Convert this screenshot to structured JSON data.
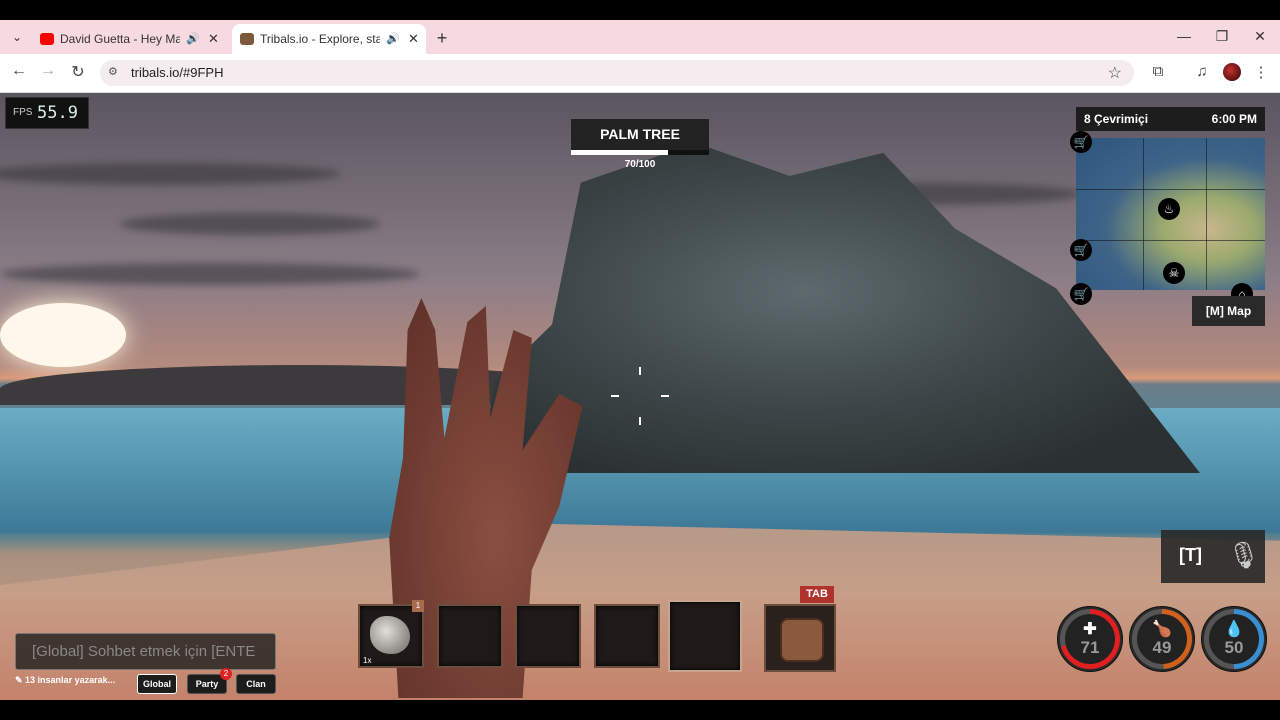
{
  "browser": {
    "tabs": [
      {
        "title": "David Guetta - Hey Mama (",
        "favicon_color": "#ff0000"
      },
      {
        "title": "Tribals.io - Explore, start cla",
        "favicon_color": "#7a5a3a"
      }
    ],
    "new_tab": "+",
    "url": "tribals.io/#9FPH",
    "window_controls": {
      "minimize": "—",
      "restore": "❐",
      "close": "✕"
    }
  },
  "hud": {
    "fps_label": "FPS",
    "fps_value": "55.9",
    "target": {
      "name": "PALM TREE",
      "hp_text": "70/100",
      "hp_fraction": 0.7
    },
    "online": "8 Çevrimiçi",
    "time": "6:00 PM",
    "map_button": "[M] Map",
    "voice_key": "[T]",
    "stats": [
      {
        "name": "health",
        "icon": "✚",
        "value": "71",
        "color": "#e02020"
      },
      {
        "name": "hunger",
        "icon": "🍗",
        "value": "49",
        "color": "#d0601e"
      },
      {
        "name": "thirst",
        "icon": "💧",
        "value": "50",
        "color": "#3a8fd0"
      }
    ],
    "hotbar": {
      "slot1_key": "1",
      "slot1_count": "1x",
      "tab_key": "TAB"
    },
    "chat": {
      "placeholder": "[Global] Sohbet etmek için [ENTE",
      "typing": "✎ 13 insanlar yazarak...",
      "channels": [
        "Global",
        "Party",
        "Clan"
      ],
      "party_badge": "2"
    }
  }
}
